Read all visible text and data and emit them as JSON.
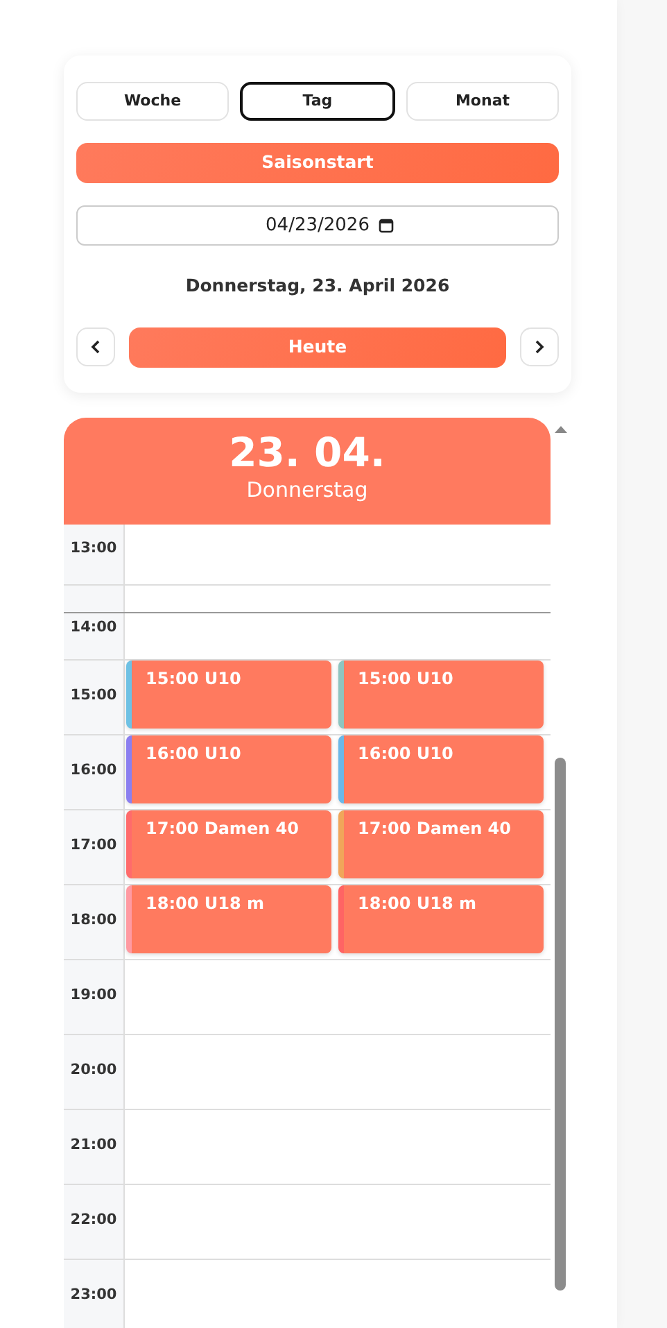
{
  "view_tabs": [
    {
      "label": "Woche",
      "selected": false
    },
    {
      "label": "Tag",
      "selected": true
    },
    {
      "label": "Monat",
      "selected": false
    }
  ],
  "season_button": "Saisonstart",
  "date_field": {
    "value": "04/23/2026"
  },
  "date_label": "Donnerstag, 23. April 2026",
  "today_button": "Heute",
  "day_header": {
    "date": "23. 04.",
    "weekday": "Donnerstag"
  },
  "hours": [
    {
      "time": "13:00"
    },
    {
      "time": "14:00",
      "now": true
    },
    {
      "time": "15:00",
      "events": [
        {
          "title": "15:00 U10",
          "color": "#6ec1e4"
        },
        {
          "title": "15:00 U10",
          "color": "#8ec5c0"
        }
      ]
    },
    {
      "time": "16:00",
      "events": [
        {
          "title": "16:00 U10",
          "color": "#8b7ff0"
        },
        {
          "title": "16:00 U10",
          "color": "#6bb8e8"
        }
      ]
    },
    {
      "time": "17:00",
      "events": [
        {
          "title": "17:00 Damen 40",
          "color": "#ff6b6b"
        },
        {
          "title": "17:00 Damen 40",
          "color": "#f0a65a"
        }
      ]
    },
    {
      "time": "18:00",
      "events": [
        {
          "title": "18:00 U18 m",
          "color": "#ff9aa2"
        },
        {
          "title": "18:00 U18 m",
          "color": "#ff6464"
        }
      ]
    },
    {
      "time": "19:00"
    },
    {
      "time": "20:00"
    },
    {
      "time": "21:00"
    },
    {
      "time": "22:00"
    },
    {
      "time": "23:00"
    }
  ]
}
